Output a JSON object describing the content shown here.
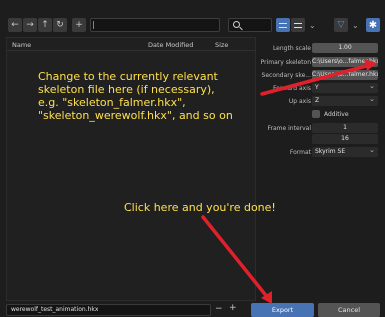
{
  "toolbar": {
    "back_icon": "←",
    "forward_icon": "→",
    "parent_icon": "↑",
    "refresh_icon": "↻",
    "new_folder_icon": "+",
    "path_value": "",
    "search_value": ""
  },
  "file_list": {
    "columns": {
      "name": "Name",
      "date": "Date Modified",
      "size": "Size"
    }
  },
  "panel": {
    "length_scale": {
      "label": "Length scale",
      "value": "1.00"
    },
    "primary_skeleton": {
      "label": "Primary skeleton",
      "value": "C:\\Users\\o...falmer.hkx"
    },
    "secondary_skeleton": {
      "label": "Secondary ske...",
      "value": "C:\\Users\\o...falmer.hkx"
    },
    "forward_axis": {
      "label": "Forward axis",
      "value": "Y"
    },
    "up_axis": {
      "label": "Up axis",
      "value": "Z"
    },
    "additive": {
      "label": "Additive"
    },
    "frame_interval": {
      "label": "Frame interval",
      "value1": "1",
      "value2": "16"
    },
    "format": {
      "label": "Format",
      "value": "Skyrim SE"
    }
  },
  "bottom": {
    "filename": "werewolf_test_animation.hkx",
    "minus": "−",
    "plus": "+",
    "export_label": "Export",
    "cancel_label": "Cancel"
  },
  "annotations": {
    "skeleton_note_lines": [
      "Change to the currently relevant",
      "skeleton file here (if necessary),",
      "e.g. \"skeleton_falmer.hkx\",",
      "\"skeleton_werewolf.hkx\", and so on"
    ],
    "export_note": "Click here and you're done!"
  },
  "colors": {
    "accent": "#4772b3",
    "annotation": "#ffe04a",
    "arrow": "#e0202a"
  }
}
